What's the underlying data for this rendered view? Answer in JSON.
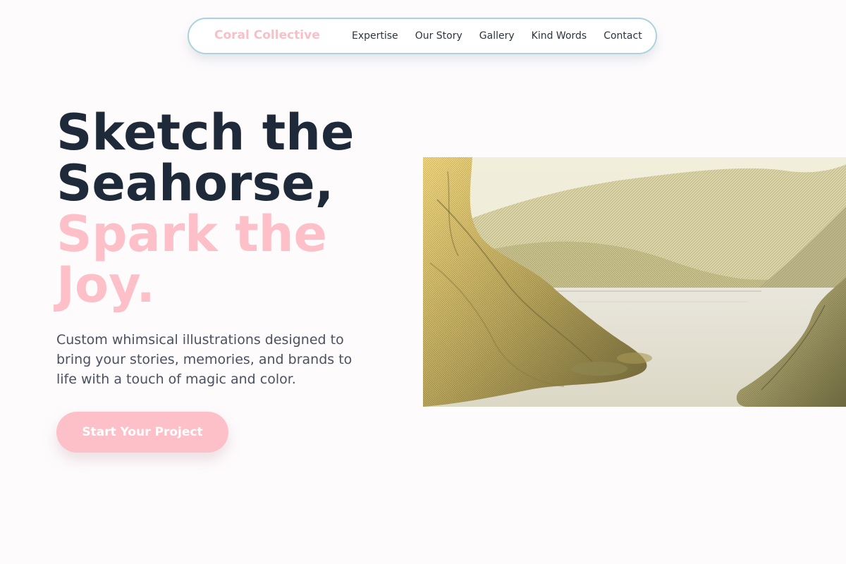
{
  "nav": {
    "brand": "Coral Collective",
    "links": [
      "Expertise",
      "Our Story",
      "Gallery",
      "Kind Words",
      "Contact"
    ]
  },
  "hero": {
    "headline_line1": "Sketch the",
    "headline_line2": "Seahorse,",
    "headline_accent_line1": "Spark the",
    "headline_accent_line2": "Joy.",
    "description": "Custom whimsical illustrations designed to bring your stories, memories, and brands to life with a touch of magic and color.",
    "cta_label": "Start Your Project"
  },
  "illustration": {
    "subject": "vintage-landscape-lake-cliffs"
  },
  "colors": {
    "accent_pink": "#fdc0c9",
    "headline_dark": "#1e2a3a",
    "nav_border": "#a9d3df",
    "background": "#fdfbfc"
  }
}
